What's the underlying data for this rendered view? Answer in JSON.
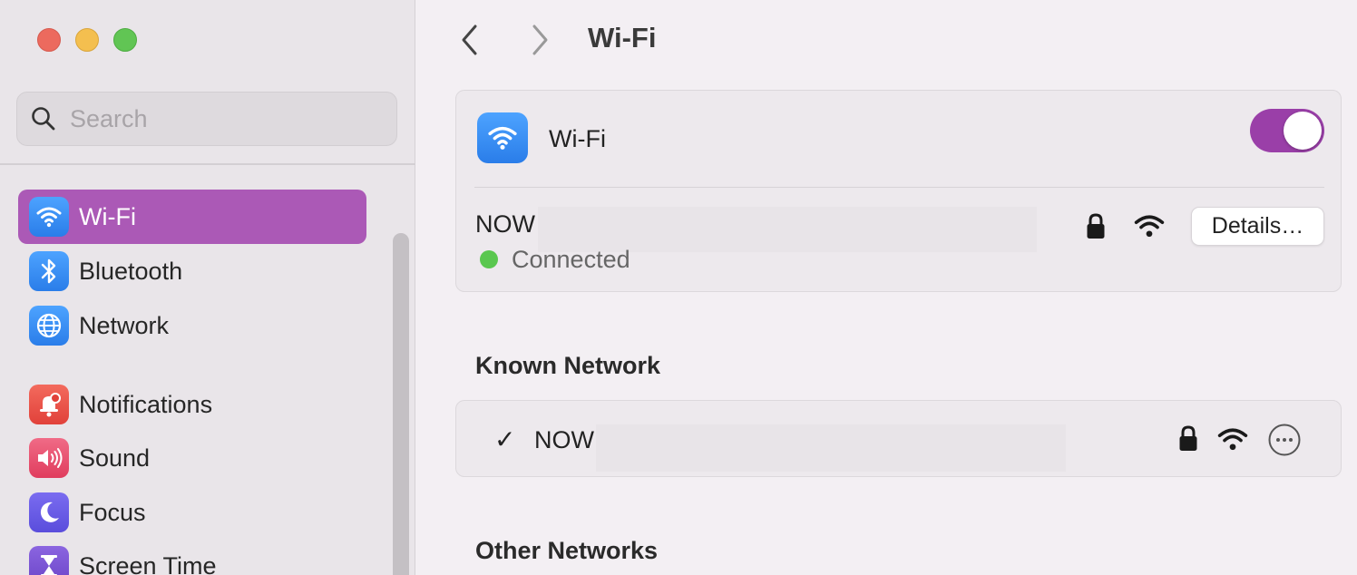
{
  "window": {
    "title": "Wi-Fi"
  },
  "sidebar": {
    "search": {
      "placeholder": "Search",
      "value": ""
    },
    "items": [
      {
        "label": "Wi-Fi",
        "icon": "wifi-icon",
        "active": true
      },
      {
        "label": "Bluetooth",
        "icon": "bluetooth-icon",
        "active": false
      },
      {
        "label": "Network",
        "icon": "globe-icon",
        "active": false
      },
      {
        "label": "Notifications",
        "icon": "bell-icon",
        "active": false
      },
      {
        "label": "Sound",
        "icon": "speaker-icon",
        "active": false
      },
      {
        "label": "Focus",
        "icon": "moon-icon",
        "active": false
      },
      {
        "label": "Screen Time",
        "icon": "hourglass-icon",
        "active": false
      }
    ]
  },
  "main": {
    "wifi_card": {
      "label": "Wi-Fi",
      "toggle_on": true,
      "current_network": {
        "name": "NOW",
        "status": "Connected",
        "details_label": "Details…"
      }
    },
    "known_section": {
      "title": "Known Network",
      "networks": [
        {
          "name": "NOW",
          "checked": true
        }
      ]
    },
    "other_section": {
      "title": "Other Networks"
    }
  },
  "colors": {
    "accent": "#ab59b6",
    "toggle": "#9a3fa8",
    "connected": "#5ac74f",
    "icon_blue": "#2a7de9"
  }
}
